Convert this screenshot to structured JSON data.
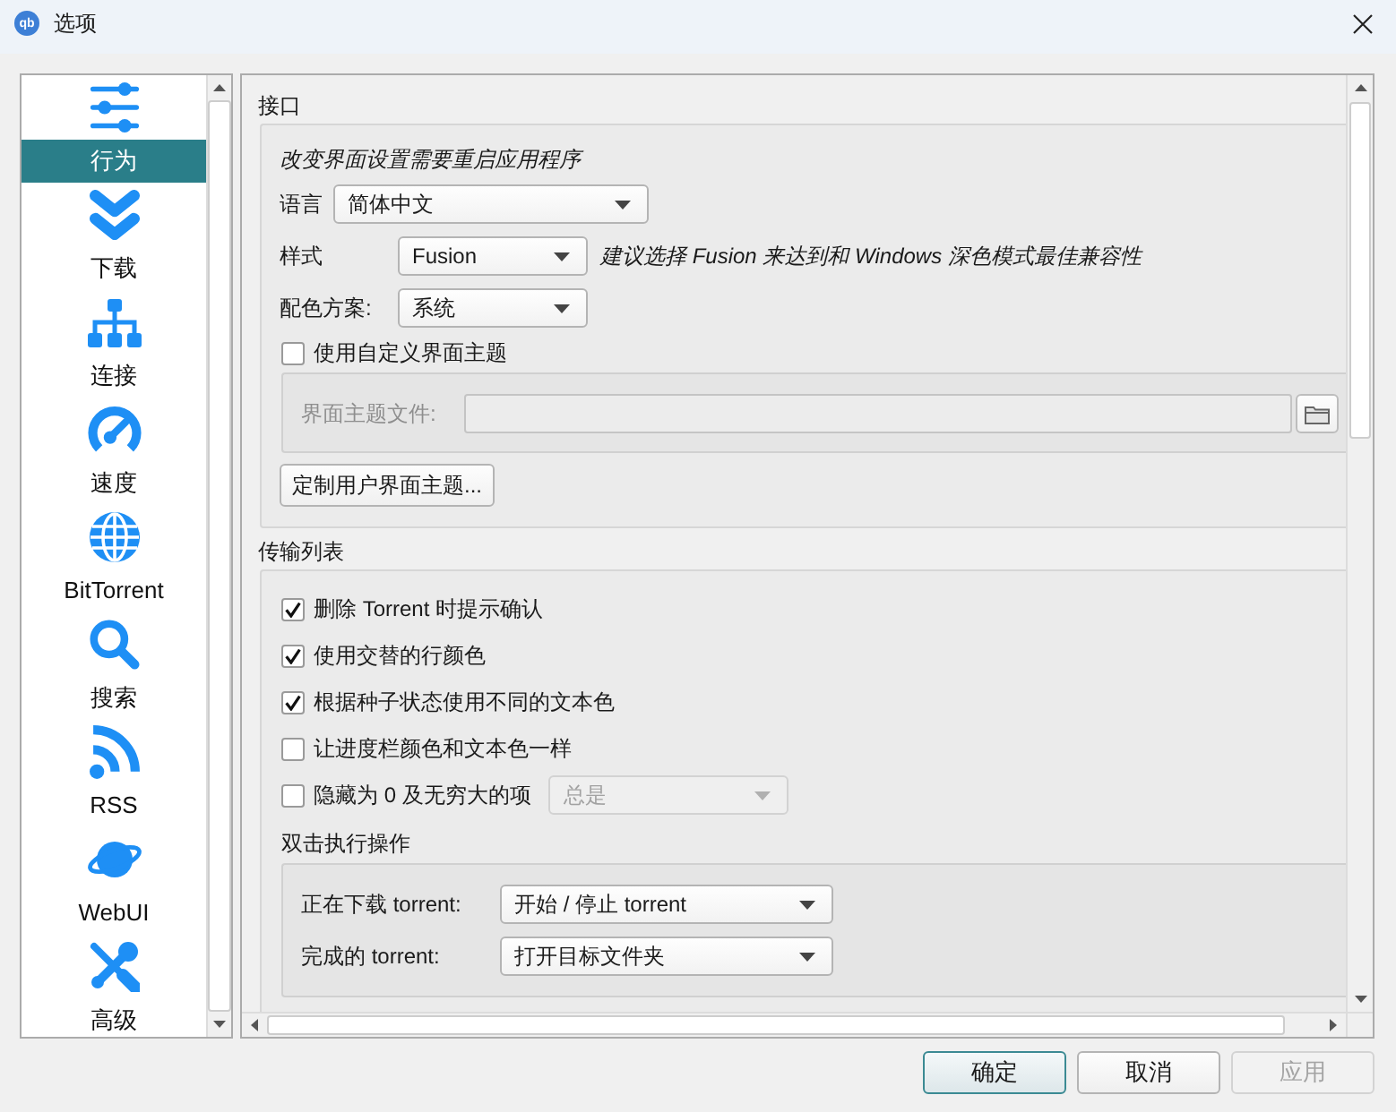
{
  "window": {
    "title": "选项",
    "logo_text": "qb"
  },
  "sidebar": {
    "items": [
      {
        "label": "行为",
        "selected": true
      },
      {
        "label": "下载",
        "selected": false
      },
      {
        "label": "连接",
        "selected": false
      },
      {
        "label": "速度",
        "selected": false
      },
      {
        "label": "BitTorrent",
        "selected": false
      },
      {
        "label": "搜索",
        "selected": false
      },
      {
        "label": "RSS",
        "selected": false
      },
      {
        "label": "WebUI",
        "selected": false
      },
      {
        "label": "高级",
        "selected": false
      }
    ]
  },
  "interface": {
    "title": "接口",
    "note": "改变界面设置需要重启应用程序",
    "language": {
      "label": "语言",
      "value": "简体中文"
    },
    "style": {
      "label": "样式",
      "value": "Fusion",
      "hint": "建议选择 Fusion 来达到和 Windows 深色模式最佳兼容性"
    },
    "color_scheme": {
      "label": "配色方案:",
      "value": "系统"
    },
    "custom_theme": {
      "label": "使用自定义界面主题",
      "checked": false
    },
    "theme_file": {
      "label": "界面主题文件:",
      "disabled": true
    },
    "customize_button": "定制用户界面主题..."
  },
  "transfer_list": {
    "title": "传输列表",
    "options": [
      {
        "label": "删除 Torrent 时提示确认",
        "checked": true
      },
      {
        "label": "使用交替的行颜色",
        "checked": true
      },
      {
        "label": "根据种子状态使用不同的文本色",
        "checked": true
      },
      {
        "label": "让进度栏颜色和文本色一样",
        "checked": false
      },
      {
        "label": "隐藏为 0 及无穷大的项",
        "checked": false,
        "combo": {
          "value": "总是",
          "disabled": true
        }
      }
    ],
    "double_click": {
      "title": "双击执行操作",
      "rows": [
        {
          "label": "正在下载 torrent:",
          "value": "开始 / 停止 torrent"
        },
        {
          "label": "完成的 torrent:",
          "value": "打开目标文件夹"
        }
      ]
    }
  },
  "buttons": [
    {
      "label": "确定",
      "default": true,
      "disabled": false
    },
    {
      "label": "取消",
      "default": false,
      "disabled": false
    },
    {
      "label": "应用",
      "default": false,
      "disabled": true
    }
  ]
}
